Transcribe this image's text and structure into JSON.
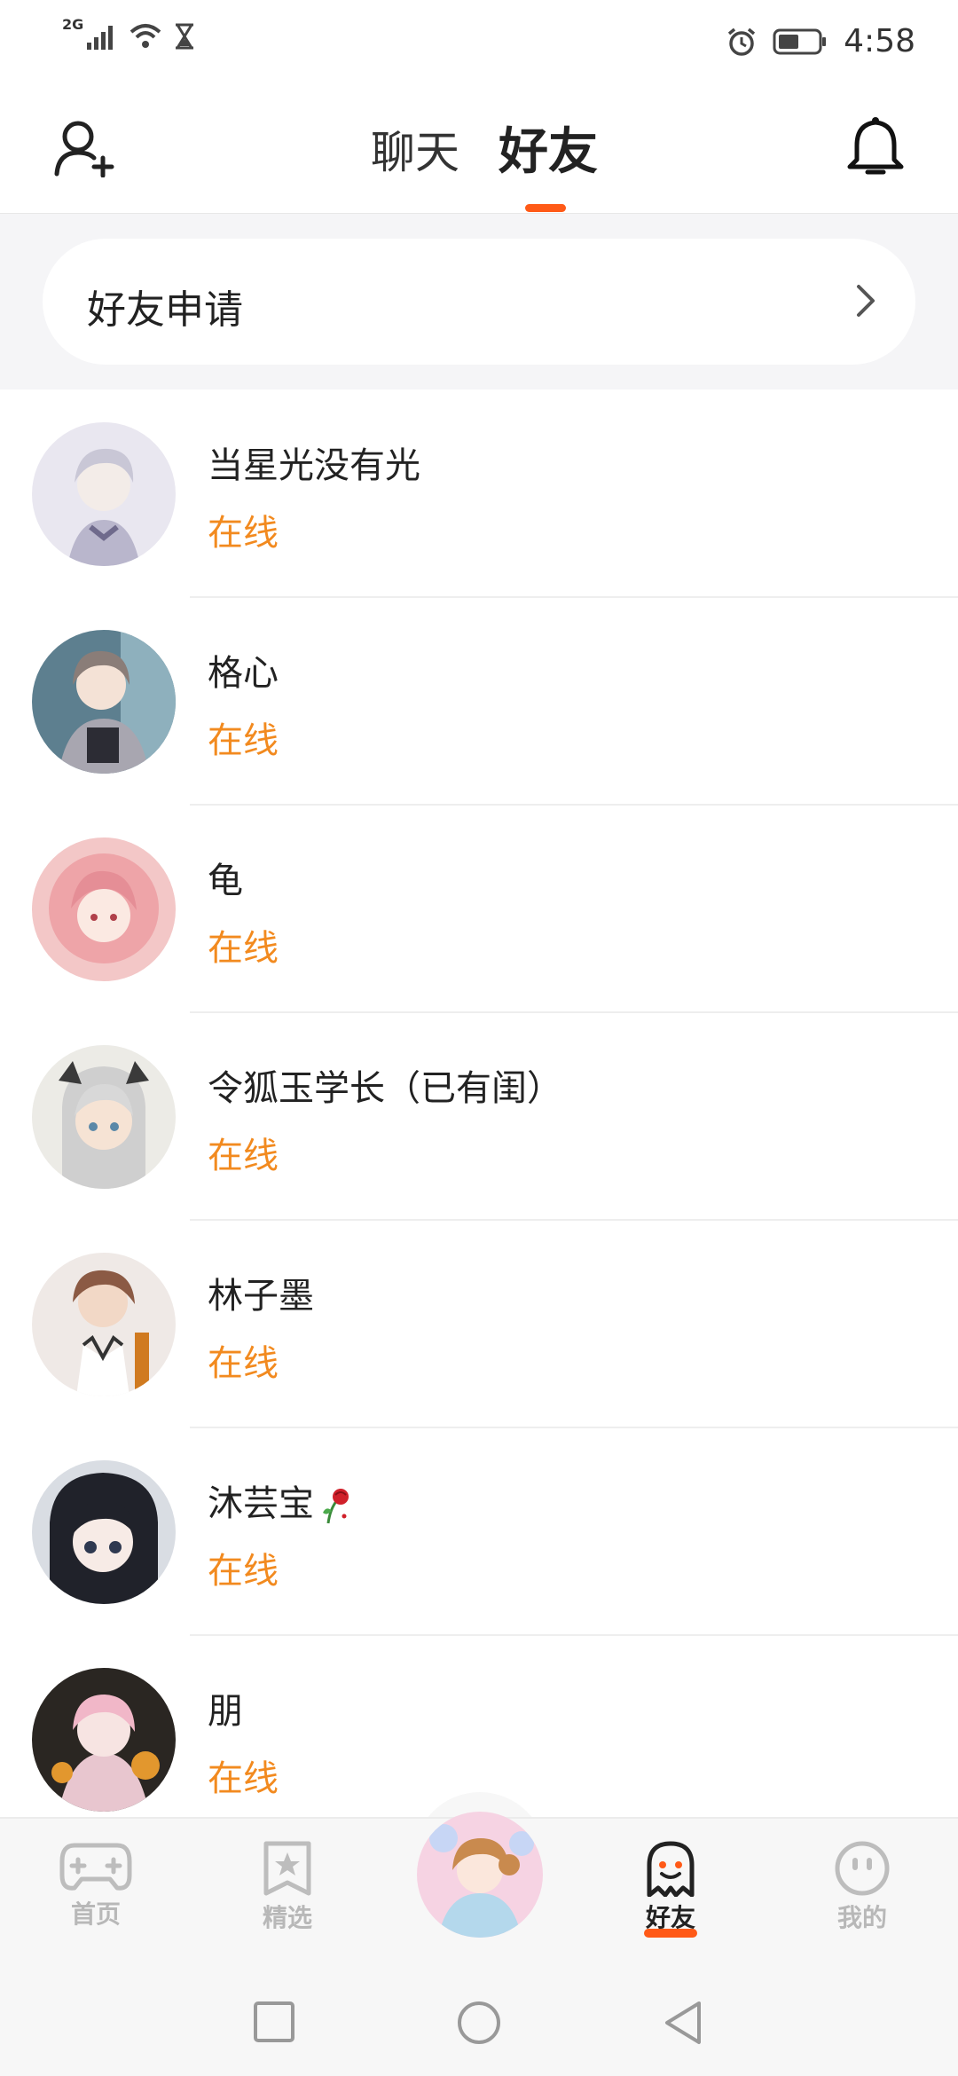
{
  "status_bar": {
    "network": "2G",
    "time": "4:58"
  },
  "header": {
    "tabs": [
      {
        "label": "聊天",
        "active": false
      },
      {
        "label": "好友",
        "active": true
      }
    ],
    "add_friend_icon": "add-user-icon",
    "notification_icon": "bell-icon"
  },
  "friend_request": {
    "label": "好友申请"
  },
  "friends": [
    {
      "name": "当星光没有光",
      "status": "在线"
    },
    {
      "name": "格心",
      "status": "在线"
    },
    {
      "name": "龟",
      "status": "在线"
    },
    {
      "name": "令狐玉学长（已有闺）",
      "status": "在线"
    },
    {
      "name": "林子墨",
      "status": "在线"
    },
    {
      "name": "沐芸宝",
      "status": "在线"
    },
    {
      "name": "朋",
      "status": "在线"
    }
  ],
  "bottom_nav": {
    "items": [
      {
        "label": "首页",
        "icon": "gamepad-icon",
        "active": false
      },
      {
        "label": "精选",
        "icon": "star-badge-icon",
        "active": false
      },
      {
        "label": "好友",
        "icon": "ghost-icon",
        "active": true
      },
      {
        "label": "我的",
        "icon": "face-icon",
        "active": false
      }
    ]
  },
  "colors": {
    "accent": "#ff5a17",
    "online": "#f28a1f",
    "inactive": "#b8b8b8"
  }
}
